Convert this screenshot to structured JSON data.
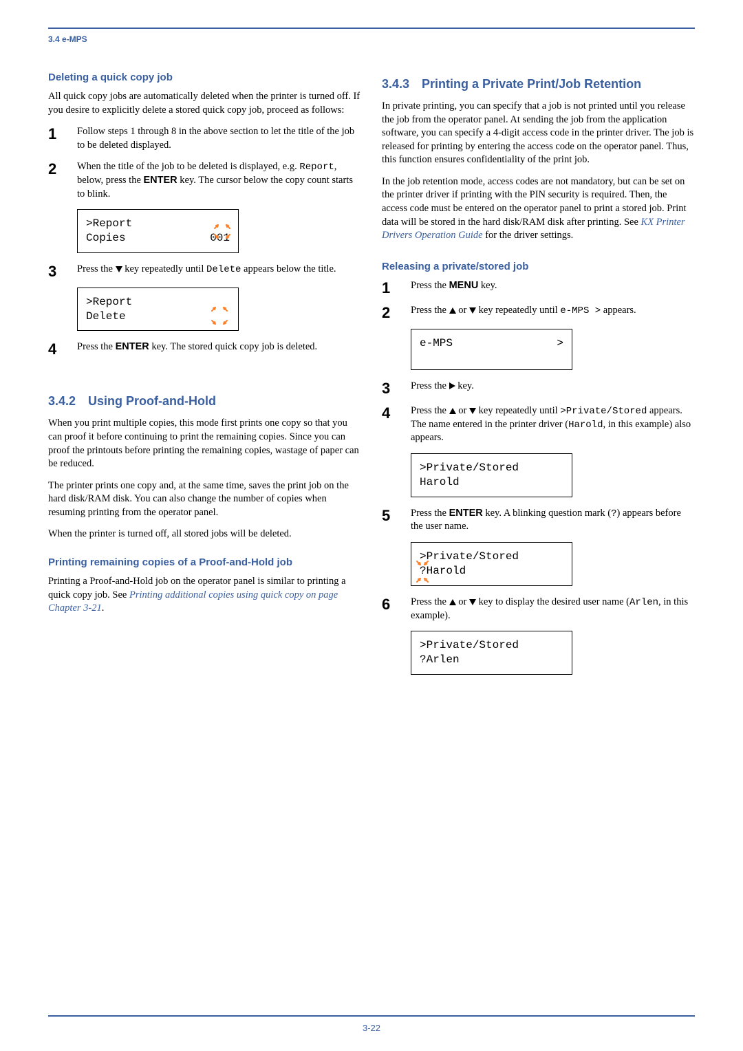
{
  "breadcrumb": "3.4 e-MPS",
  "left": {
    "h_del": "Deleting a quick copy job",
    "p_del": "All quick copy jobs are automatically deleted when the printer is turned off. If you desire to explicitly delete a stored quick copy job, proceed as follows:",
    "s1_a": "Follow steps 1 through 8 in the above section to let the title of the job to be deleted displayed.",
    "s2_a": "When the title of the job to be deleted is displayed, e.g. ",
    "s2_b": "Report",
    "s2_c": ", below, press the ",
    "s2_d": "ENTER",
    "s2_e": " key. The cursor below the copy count starts to blink.",
    "disp1_l1": ">Report",
    "disp1_l2a": "Copies",
    "disp1_l2b": "001",
    "s3_a": "Press the ",
    "s3_b": " key repeatedly until ",
    "s3_c": "Delete",
    "s3_d": " appears below the title.",
    "disp2_l1": ">Report",
    "disp2_l2": " Delete",
    "s4_a": "Press the ",
    "s4_b": "ENTER",
    "s4_c": " key. The stored quick copy job is deleted.",
    "h_342_num": "3.4.2",
    "h_342_txt": "Using Proof-and-Hold",
    "p342a": "When you print multiple copies, this mode first prints one copy so that you can proof it before continuing to print the remaining copies. Since you can proof the printouts before printing the remaining copies, wastage of paper can be reduced.",
    "p342b": "The printer prints one copy and, at the same time, saves the print job on the hard disk/RAM disk. You can also change the number of copies when resuming printing from the operator panel.",
    "p342c": "When the printer is turned off, all stored jobs will be deleted.",
    "h_print_remain": "Printing remaining copies of a Proof-and-Hold job",
    "p_print_remain_a": "Printing a Proof-and-Hold job on the operator panel is similar to printing a quick copy job. See ",
    "p_print_remain_link": "Printing additional copies using quick copy on page Chapter 3-21",
    "p_print_remain_b": "."
  },
  "right": {
    "h_343_num": "3.4.3",
    "h_343_txt": "Printing a Private Print/Job Retention",
    "p343a": "In private printing, you can specify that a job is not printed until you release the job from the operator panel. At sending the job from the application software, you can specify a 4-digit access code in the printer driver. The job is released for printing by entering the access code on the operator panel. Thus, this function ensures confidentiality of the print job.",
    "p343b_a": "In the job retention mode, access codes are not mandatory, but can be set on the printer driver if printing with the PIN security is required. Then, the access code must be entered on the operator panel to print a stored job. Print data will be stored in the hard disk/RAM disk after printing. See ",
    "p343b_link": "KX Printer Drivers Operation Guide",
    "p343b_b": " for the driver settings.",
    "h_release": "Releasing a private/stored job",
    "s1_a": "Press the ",
    "s1_b": "MENU",
    "s1_c": " key.",
    "s2_a": "Press the ",
    "s2_b": " or ",
    "s2_c": " key repeatedly until ",
    "s2_d": "e-MPS >",
    "s2_e": " appears.",
    "disp3_l1a": "e-MPS",
    "disp3_l1b": ">",
    "s3_a": "Press the ",
    "s3_b": " key.",
    "s4_a": "Press the ",
    "s4_b": " or ",
    "s4_c": " key repeatedly until ",
    "s4_d": ">Private/Stored",
    "s4_e": " appears. The name entered in the printer driver (",
    "s4_f": "Harold",
    "s4_g": ", in this example) also appears.",
    "disp4_l1": ">Private/Stored",
    "disp4_l2": " Harold",
    "s5_a": "Press the ",
    "s5_b": "ENTER",
    "s5_c": " key. A blinking question mark (",
    "s5_d": "?",
    "s5_e": ") appears before the user name.",
    "disp5_l1": ">Private/Stored",
    "disp5_l2": "?Harold",
    "s6_a": "Press the ",
    "s6_b": " or ",
    "s6_c": " key to display the desired user name (",
    "s6_d": "Arlen",
    "s6_e": ", in this example).",
    "disp6_l1": ">Private/Stored",
    "disp6_l2": "?Arlen"
  },
  "pagenum": "3-22"
}
